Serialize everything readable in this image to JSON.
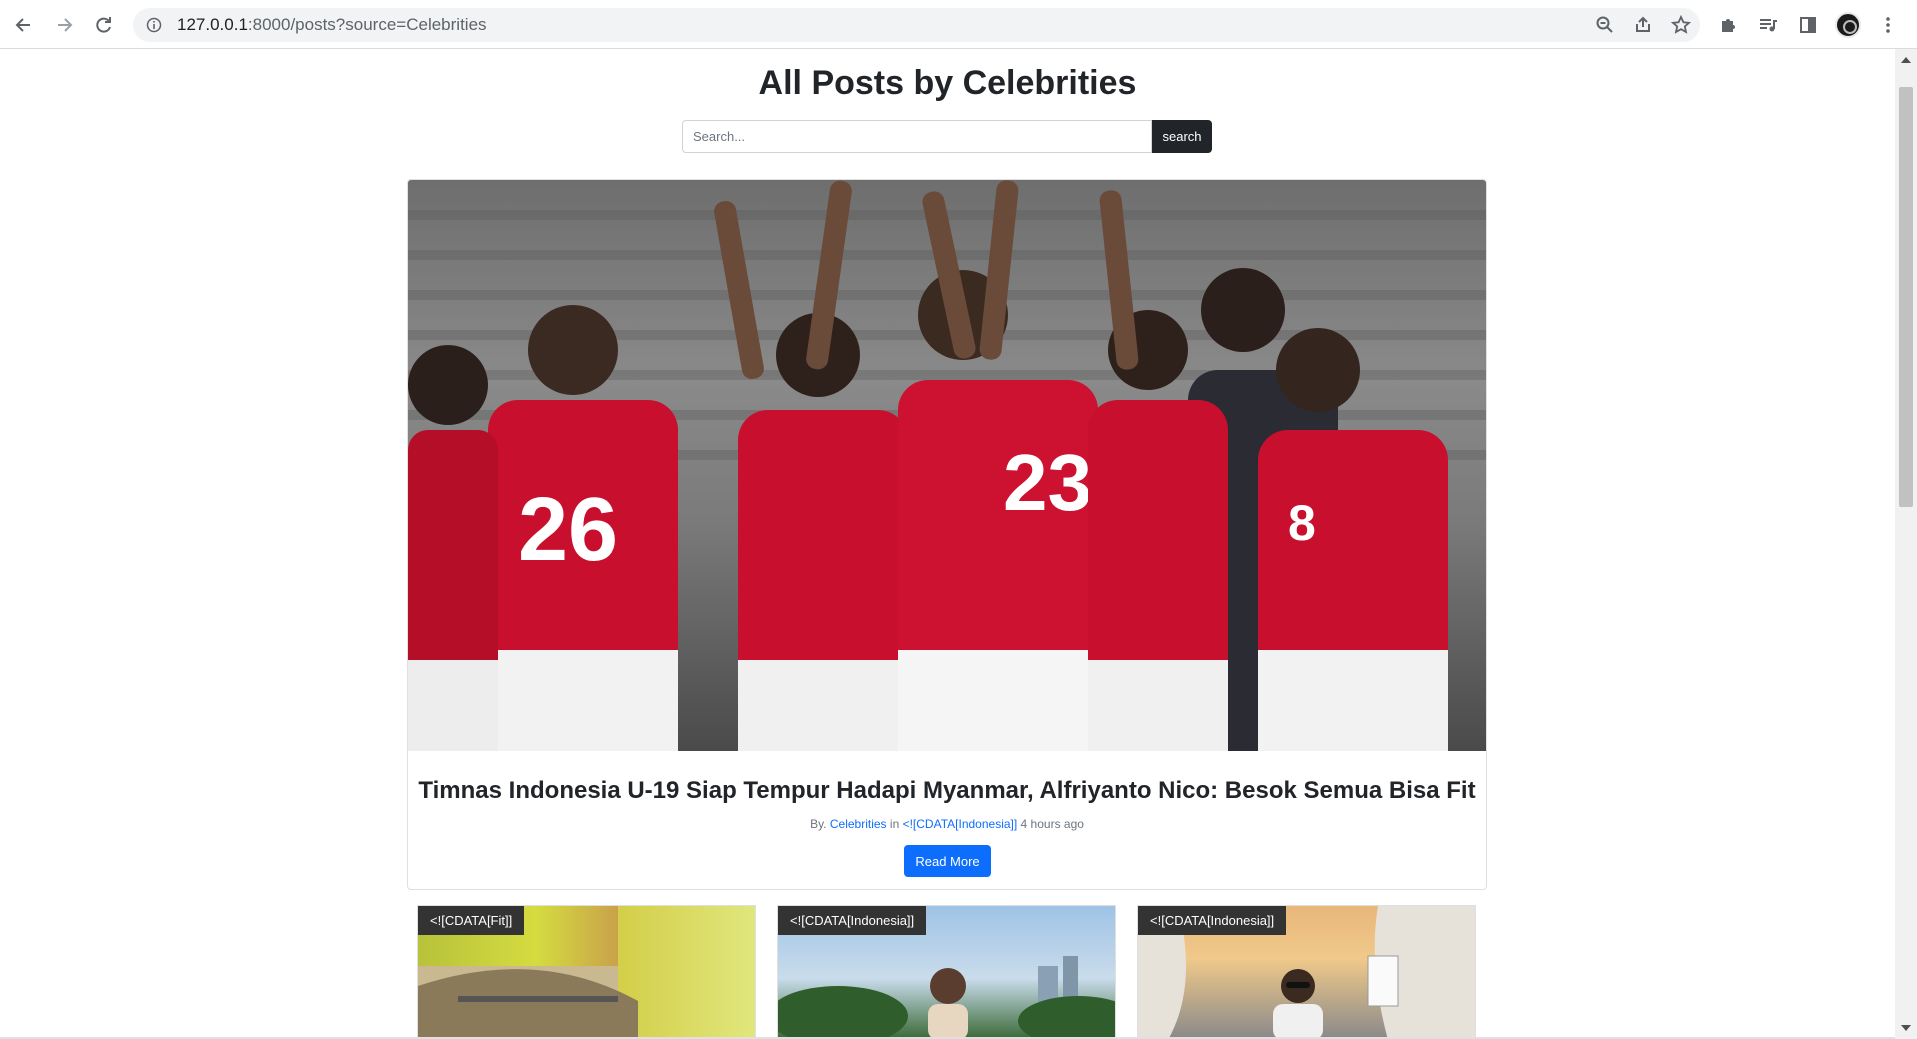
{
  "browser": {
    "url_host": "127.0.0.1",
    "url_path": ":8000/posts?source=Celebrities",
    "icons": {
      "back": "arrow-left-icon",
      "forward": "arrow-right-icon",
      "reload": "reload-icon",
      "site_info": "info-icon",
      "zoom": "zoom-icon",
      "share": "share-icon",
      "bookmark": "star-icon",
      "extensions": "puzzle-icon",
      "media": "media-queue-icon",
      "side_panel": "side-panel-icon",
      "menu": "kebab-menu-icon"
    }
  },
  "page": {
    "title": "All Posts by Celebrities",
    "search": {
      "placeholder": "Search...",
      "button_label": "search"
    }
  },
  "featured_post": {
    "title": "Timnas Indonesia U-19 Siap Tempur Hadapi Myanmar, Alfriyanto Nico: Besok Semua Bisa Fit",
    "meta_prefix": "By.",
    "author": "Celebrities",
    "meta_in": "in",
    "category": "<![CDATA[Indonesia]]",
    "time_ago": "4 hours ago",
    "read_more_label": "Read More",
    "jersey_numbers": [
      "26",
      "23",
      "8"
    ]
  },
  "posts": [
    {
      "tag": "<![CDATA[Fit]]"
    },
    {
      "tag": "<![CDATA[Indonesia]]"
    },
    {
      "tag": "<![CDATA[Indonesia]]"
    }
  ],
  "colors": {
    "primary": "#0d6efd",
    "dark": "#212529",
    "jersey_red": "#c8102e"
  }
}
